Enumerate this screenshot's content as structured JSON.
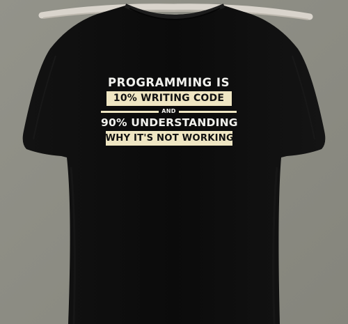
{
  "colors": {
    "background": "#8c8c82",
    "shirt": "#0d0d0d",
    "band_fill": "#efe6c3",
    "text_white": "#f2f2ee",
    "hanger": "#d9d4cc"
  },
  "print": {
    "line1": "PROGRAMMING IS",
    "band1": "10% WRITING CODE",
    "connector": "AND",
    "line3": "90% UNDERSTANDING",
    "band2": "WHY IT'S NOT WORKING"
  }
}
